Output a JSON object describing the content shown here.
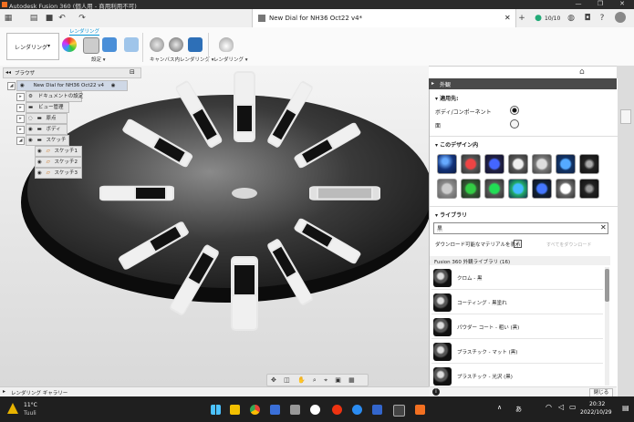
{
  "window": {
    "title": "Autodesk Fusion 360 (個人用 - 商用利用不可)",
    "controls": [
      "—",
      "❐",
      "✕"
    ]
  },
  "appbar": {
    "document_tab": "New Dial for NH36 Oct22 v4*",
    "job_count": "10/10"
  },
  "ribbon": {
    "tab": "レンダリング",
    "workspace": "レンダリング",
    "groups": [
      {
        "label": "設定 ▾"
      },
      {
        "label": "キャンバス内レンダリング ▾"
      },
      {
        "label": "レンダリング ▾"
      }
    ]
  },
  "browser": {
    "title": "ブラウザ",
    "root": "New Dial for NH36 Oct22 v4",
    "items": [
      "ドキュメントの設定",
      "ビュー管理",
      "原点",
      "ボディ",
      "スケッチ"
    ],
    "sketches": [
      "スケッチ1",
      "スケッチ2",
      "スケッチ3"
    ]
  },
  "appearance": {
    "title": "外観",
    "apply_to_header": "適用先:",
    "apply_options": [
      {
        "label": "ボディ/コンポーネント",
        "selected": true
      },
      {
        "label": "面",
        "selected": false
      }
    ],
    "in_design_header": "このデザイン内",
    "library_header": "ライブラリ",
    "search_value": "黒",
    "download_checkbox_label": "ダウンロード可能なマテリアルを表示",
    "download_all_label": "すべてをダウンロード",
    "library_folder": "Fusion 360 外観ライブラリ (16)",
    "library_items": [
      "クロム - 黒",
      "コーティング - 黒塗れ",
      "パウダー コート - 粗い (黒)",
      "プラスチック - マット (黒)",
      "プラスチック - 光沢 (黒)"
    ],
    "close_button": "閉じる",
    "info_icon": "i"
  },
  "status_bar": {
    "label": "レンダリング ギャラリー"
  },
  "taskbar": {
    "weather_temp": "11°C",
    "weather_desc": "Tuuli",
    "ime_label": "あ",
    "time": "20:32",
    "date": "2022/10/29"
  },
  "colors": {
    "accent": "#0696d7",
    "titlebar": "#2b2b2b",
    "taskbar": "#1f1f1f",
    "panel_header": "#4a4a4a"
  }
}
